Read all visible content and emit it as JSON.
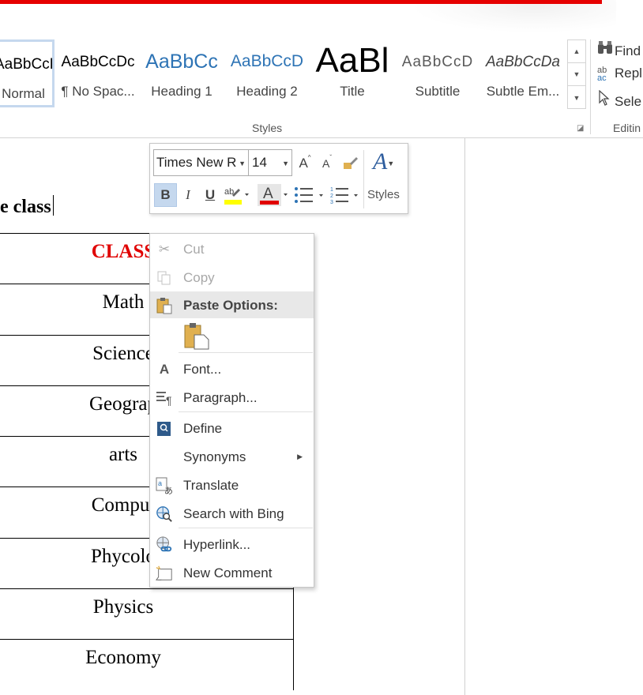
{
  "ribbon": {
    "styles": [
      {
        "preview": "AaBbCcDc",
        "name": "Normal",
        "selected": true
      },
      {
        "preview": "AaBbCcDc",
        "name": "¶ No Spac..."
      },
      {
        "preview": "AaBbCc",
        "name": "Heading 1"
      },
      {
        "preview": "AaBbCcD",
        "name": "Heading 2"
      },
      {
        "preview": "AaBl",
        "name": "Title"
      },
      {
        "preview": "AaBbCcD",
        "name": "Subtitle"
      },
      {
        "preview": "AaBbCcDa",
        "name": "Subtle Em..."
      }
    ],
    "styles_group_label": "Styles",
    "editing_group_label": "Editin",
    "find_label": "Find",
    "replace_label": "Repl",
    "select_label": "Sele",
    "colors": {
      "heading1": "#2e74b5",
      "accent_selected": "#c5d8ee",
      "redline": "#e60000"
    }
  },
  "document": {
    "heading": "e class",
    "table_rows": [
      "CLASS",
      "Math",
      "Science",
      "Geograp",
      "arts",
      "Comput",
      "Phycolo",
      "Physics",
      "Economy"
    ],
    "header_color": "#e00000"
  },
  "mini_toolbar": {
    "font_name": "Times New R",
    "font_size": "14",
    "grow_font": "A",
    "shrink_font": "A",
    "bold": "B",
    "italic": "I",
    "underline": "U",
    "font_color_glyph": "A",
    "styles_label": "Styles",
    "highlight_color": "#ffff00",
    "font_color": "#e00000"
  },
  "context_menu": {
    "items": [
      {
        "label": "Cut",
        "icon": "scissors-icon",
        "enabled": false
      },
      {
        "label": "Copy",
        "icon": "copy-icon",
        "enabled": false
      },
      {
        "label": "Paste Options:",
        "icon": "paste-icon",
        "header": true
      },
      {
        "label": "Font...",
        "icon": "font-icon"
      },
      {
        "label": "Paragraph...",
        "icon": "paragraph-icon"
      },
      {
        "label": "Define",
        "icon": "book-icon"
      },
      {
        "label": "Synonyms",
        "icon": "",
        "submenu": true
      },
      {
        "label": "Translate",
        "icon": "translate-icon"
      },
      {
        "label": "Search with Bing",
        "icon": "search-icon"
      },
      {
        "label": "Hyperlink...",
        "icon": "link-icon"
      },
      {
        "label": "New Comment",
        "icon": "comment-icon"
      }
    ]
  }
}
